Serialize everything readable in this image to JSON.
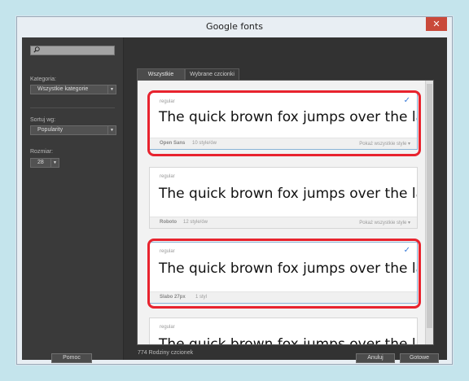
{
  "window": {
    "title": "Google fonts",
    "close_label": "✕"
  },
  "sidebar": {
    "search": {
      "value": "",
      "placeholder": ""
    },
    "category_label": "Kategoria:",
    "category_value": "Wszystkie kategorie",
    "sort_label": "Sortuj wg:",
    "sort_value": "Popularity",
    "size_label": "Rozmiar:",
    "size_value": "28",
    "help_label": "Pomoc"
  },
  "tabs": [
    {
      "label": "Wszystkie",
      "active": true
    },
    {
      "label": "Wybrane czcionki",
      "active": false
    }
  ],
  "cards": [
    {
      "style": "regular",
      "sample": "The quick brown fox jumps over the lazy dog",
      "name": "Open Sans",
      "count": "10 style/ów",
      "show_all": "Pokaż wszystkie style",
      "selected": true
    },
    {
      "style": "regular",
      "sample": "The quick brown fox jumps over the lazy dog",
      "name": "Roboto",
      "count": "12 style/ów",
      "show_all": "Pokaż wszystkie style",
      "selected": false
    },
    {
      "style": "regular",
      "sample": "The quick brown fox jumps over the lazy dog",
      "name": "Slabo 27px",
      "count": "1 styl",
      "show_all": "",
      "selected": true
    },
    {
      "style": "regular",
      "sample": "The quick brown fox jumps over the lazy dog",
      "name": "",
      "count": "",
      "show_all": "",
      "selected": false
    }
  ],
  "footer": {
    "families_count": "774 Rodziny czcionek",
    "cancel_label": "Anuluj",
    "done_label": "Gotowe"
  },
  "colors": {
    "highlight": "#e8232e",
    "check": "#3b7dd8",
    "close": "#c9493a"
  }
}
